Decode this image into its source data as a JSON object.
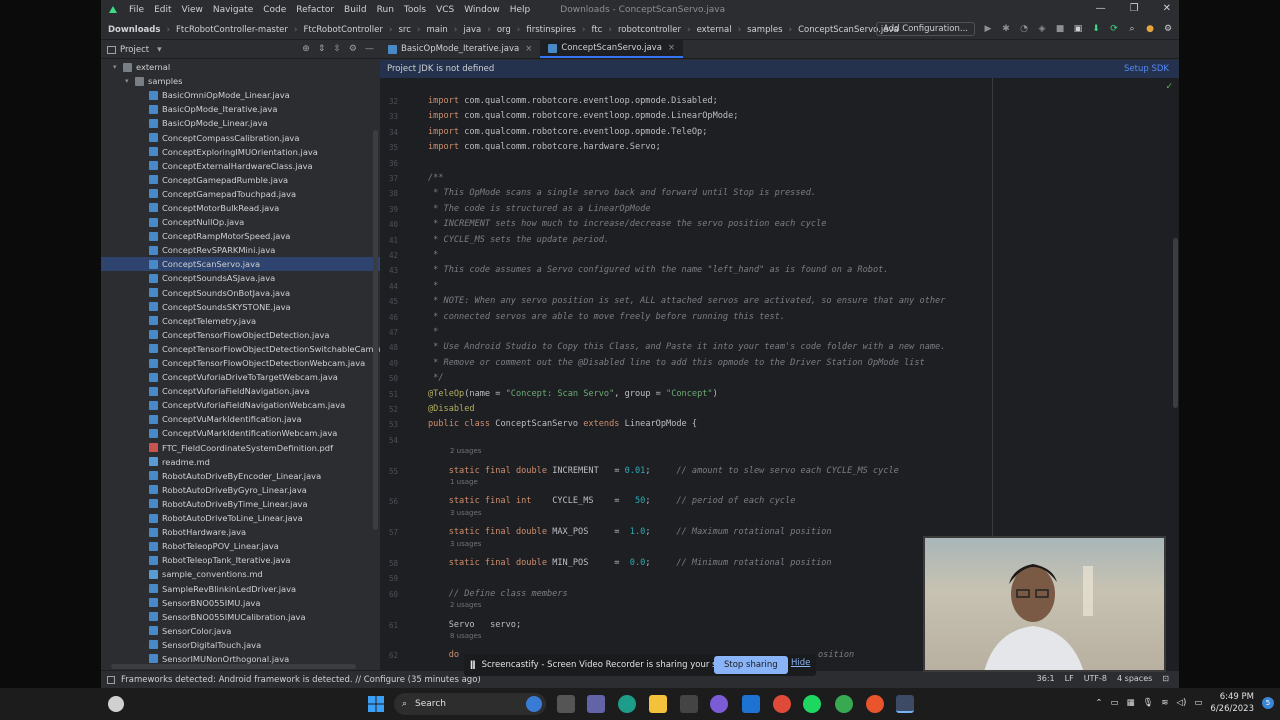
{
  "menubar": {
    "items": [
      "File",
      "Edit",
      "View",
      "Navigate",
      "Code",
      "Refactor",
      "Build",
      "Run",
      "Tools",
      "VCS",
      "Window",
      "Help"
    ],
    "title": "Downloads - ConceptScanServo.java"
  },
  "breadcrumbs": [
    "Downloads",
    "FtcRobotController-master",
    "FtcRobotController",
    "src",
    "main",
    "java",
    "org",
    "firstinspires",
    "ftc",
    "robotcontroller",
    "external",
    "samples",
    "ConceptScanServo.java"
  ],
  "toolbar": {
    "add_config": "Add Configuration..."
  },
  "project_panel": {
    "title": "Project",
    "tree": [
      {
        "label": "external",
        "type": "folder",
        "level": 1,
        "expanded": true
      },
      {
        "label": "samples",
        "type": "folder",
        "level": 2,
        "expanded": true
      },
      {
        "label": "BasicOmniOpMode_Linear.java",
        "type": "java",
        "level": 3
      },
      {
        "label": "BasicOpMode_Iterative.java",
        "type": "java",
        "level": 3
      },
      {
        "label": "BasicOpMode_Linear.java",
        "type": "java",
        "level": 3
      },
      {
        "label": "ConceptCompassCalibration.java",
        "type": "java",
        "level": 3
      },
      {
        "label": "ConceptExploringIMUOrientation.java",
        "type": "java",
        "level": 3
      },
      {
        "label": "ConceptExternalHardwareClass.java",
        "type": "java",
        "level": 3
      },
      {
        "label": "ConceptGamepadRumble.java",
        "type": "java",
        "level": 3
      },
      {
        "label": "ConceptGamepadTouchpad.java",
        "type": "java",
        "level": 3
      },
      {
        "label": "ConceptMotorBulkRead.java",
        "type": "java",
        "level": 3
      },
      {
        "label": "ConceptNullOp.java",
        "type": "java",
        "level": 3
      },
      {
        "label": "ConceptRampMotorSpeed.java",
        "type": "java",
        "level": 3
      },
      {
        "label": "ConceptRevSPARKMini.java",
        "type": "java",
        "level": 3
      },
      {
        "label": "ConceptScanServo.java",
        "type": "java",
        "level": 3,
        "selected": true
      },
      {
        "label": "ConceptSoundsASJava.java",
        "type": "java",
        "level": 3
      },
      {
        "label": "ConceptSoundsOnBotJava.java",
        "type": "java",
        "level": 3
      },
      {
        "label": "ConceptSoundsSKYSTONE.java",
        "type": "java",
        "level": 3
      },
      {
        "label": "ConceptTelemetry.java",
        "type": "java",
        "level": 3
      },
      {
        "label": "ConceptTensorFlowObjectDetection.java",
        "type": "java",
        "level": 3
      },
      {
        "label": "ConceptTensorFlowObjectDetectionSwitchableCameras.ja",
        "type": "java",
        "level": 3
      },
      {
        "label": "ConceptTensorFlowObjectDetectionWebcam.java",
        "type": "java",
        "level": 3
      },
      {
        "label": "ConceptVuforiaDriveToTargetWebcam.java",
        "type": "java",
        "level": 3
      },
      {
        "label": "ConceptVuforiaFieldNavigation.java",
        "type": "java",
        "level": 3
      },
      {
        "label": "ConceptVuforiaFieldNavigationWebcam.java",
        "type": "java",
        "level": 3
      },
      {
        "label": "ConceptVuMarkIdentification.java",
        "type": "java",
        "level": 3
      },
      {
        "label": "ConceptVuMarkIdentificationWebcam.java",
        "type": "java",
        "level": 3
      },
      {
        "label": "FTC_FieldCoordinateSystemDefinition.pdf",
        "type": "pdf",
        "level": 3
      },
      {
        "label": "readme.md",
        "type": "md",
        "level": 3
      },
      {
        "label": "RobotAutoDriveByEncoder_Linear.java",
        "type": "java",
        "level": 3
      },
      {
        "label": "RobotAutoDriveByGyro_Linear.java",
        "type": "java",
        "level": 3
      },
      {
        "label": "RobotAutoDriveByTime_Linear.java",
        "type": "java",
        "level": 3
      },
      {
        "label": "RobotAutoDriveToLine_Linear.java",
        "type": "java",
        "level": 3
      },
      {
        "label": "RobotHardware.java",
        "type": "java",
        "level": 3
      },
      {
        "label": "RobotTeleopPOV_Linear.java",
        "type": "java",
        "level": 3
      },
      {
        "label": "RobotTeleopTank_Iterative.java",
        "type": "java",
        "level": 3
      },
      {
        "label": "sample_conventions.md",
        "type": "md",
        "level": 3
      },
      {
        "label": "SampleRevBlinkinLedDriver.java",
        "type": "java",
        "level": 3
      },
      {
        "label": "SensorBNO055IMU.java",
        "type": "java",
        "level": 3
      },
      {
        "label": "SensorBNO055IMUCalibration.java",
        "type": "java",
        "level": 3
      },
      {
        "label": "SensorColor.java",
        "type": "java",
        "level": 3
      },
      {
        "label": "SensorDigitalTouch.java",
        "type": "java",
        "level": 3
      },
      {
        "label": "SensorIMUNonOrthogonal.java",
        "type": "java",
        "level": 3
      }
    ]
  },
  "tabs": [
    {
      "label": "BasicOpMode_Iterative.java",
      "active": false
    },
    {
      "label": "ConceptScanServo.java",
      "active": true
    }
  ],
  "banner": {
    "text": "Project JDK is not defined",
    "link": "Setup SDK"
  },
  "editor": {
    "lines": [
      {
        "n": "32",
        "tokens": [
          [
            "kw",
            "import "
          ],
          [
            "id",
            "com.qualcomm.robotcore.eventloop.opmode.Disabled;"
          ]
        ]
      },
      {
        "n": "33",
        "tokens": [
          [
            "kw",
            "import "
          ],
          [
            "id",
            "com.qualcomm.robotcore.eventloop.opmode.LinearOpMode;"
          ]
        ]
      },
      {
        "n": "34",
        "tokens": [
          [
            "kw",
            "import "
          ],
          [
            "id",
            "com.qualcomm.robotcore.eventloop.opmode.TeleOp;"
          ]
        ]
      },
      {
        "n": "35",
        "tokens": [
          [
            "kw",
            "import "
          ],
          [
            "id",
            "com.qualcomm.robotcore.hardware.Servo;"
          ]
        ]
      },
      {
        "n": "36",
        "tokens": []
      },
      {
        "n": "37",
        "tokens": [
          [
            "cm",
            "/**"
          ]
        ]
      },
      {
        "n": "38",
        "tokens": [
          [
            "cm",
            " * This OpMode scans a single servo back and forward until Stop is pressed."
          ]
        ]
      },
      {
        "n": "39",
        "tokens": [
          [
            "cm",
            " * The code is structured as a LinearOpMode"
          ]
        ]
      },
      {
        "n": "40",
        "tokens": [
          [
            "cm",
            " * INCREMENT sets how much to increase/decrease the servo position each cycle"
          ]
        ]
      },
      {
        "n": "41",
        "tokens": [
          [
            "cm",
            " * CYCLE_MS sets the update period."
          ]
        ]
      },
      {
        "n": "42",
        "tokens": [
          [
            "cm",
            " *"
          ]
        ]
      },
      {
        "n": "43",
        "tokens": [
          [
            "cm",
            " * This code assumes a Servo configured with the name \"left_hand\" as is found on a Robot."
          ]
        ]
      },
      {
        "n": "44",
        "tokens": [
          [
            "cm",
            " *"
          ]
        ]
      },
      {
        "n": "45",
        "tokens": [
          [
            "cm",
            " * NOTE: When any servo position is set, ALL attached servos are activated, so ensure that any other"
          ]
        ]
      },
      {
        "n": "46",
        "tokens": [
          [
            "cm",
            " * connected servos are able to move freely before running this test."
          ]
        ]
      },
      {
        "n": "47",
        "tokens": [
          [
            "cm",
            " *"
          ]
        ]
      },
      {
        "n": "48",
        "tokens": [
          [
            "cm",
            " * Use Android Studio to Copy this Class, and Paste it into your team's code folder with a new name."
          ]
        ]
      },
      {
        "n": "49",
        "tokens": [
          [
            "cm",
            " * Remove or comment out the @Disabled line to add this opmode to the Driver Station OpMode list"
          ]
        ]
      },
      {
        "n": "50",
        "tokens": [
          [
            "cm",
            " */"
          ]
        ]
      },
      {
        "n": "51",
        "tokens": [
          [
            "an",
            "@TeleOp"
          ],
          [
            "id",
            "(name = "
          ],
          [
            "st",
            "\"Concept: Scan Servo\""
          ],
          [
            "id",
            ", group = "
          ],
          [
            "st",
            "\"Concept\""
          ],
          [
            "id",
            ")"
          ]
        ]
      },
      {
        "n": "52",
        "tokens": [
          [
            "an",
            "@Disabled"
          ]
        ]
      },
      {
        "n": "53",
        "tokens": [
          [
            "kw",
            "public class "
          ],
          [
            "id",
            "ConceptScanServo "
          ],
          [
            "kw",
            "extends "
          ],
          [
            "id",
            "LinearOpMode {"
          ]
        ]
      },
      {
        "n": "54",
        "tokens": []
      },
      {
        "n": "55",
        "usage": "2 usages",
        "tokens": [
          [
            "kw",
            "    static final double "
          ],
          [
            "id",
            "INCREMENT   = "
          ],
          [
            "nm",
            "0.01"
          ],
          [
            "id",
            ";     "
          ],
          [
            "cm",
            "// amount to slew servo each CYCLE_MS cycle"
          ]
        ]
      },
      {
        "n": "56",
        "usage": "1 usage",
        "tokens": [
          [
            "kw",
            "    static final int    "
          ],
          [
            "id",
            "CYCLE_MS    =   "
          ],
          [
            "nm",
            "50"
          ],
          [
            "id",
            ";     "
          ],
          [
            "cm",
            "// period of each cycle"
          ]
        ]
      },
      {
        "n": "57",
        "usage": "3 usages",
        "tokens": [
          [
            "kw",
            "    static final double "
          ],
          [
            "id",
            "MAX_POS     =  "
          ],
          [
            "nm",
            "1.0"
          ],
          [
            "id",
            ";     "
          ],
          [
            "cm",
            "// Maximum rotational position"
          ]
        ]
      },
      {
        "n": "58",
        "usage": "3 usages",
        "tokens": [
          [
            "kw",
            "    static final double "
          ],
          [
            "id",
            "MIN_POS     =  "
          ],
          [
            "nm",
            "0.0"
          ],
          [
            "id",
            ";     "
          ],
          [
            "cm",
            "// Minimum rotational position"
          ]
        ]
      },
      {
        "n": "59",
        "tokens": []
      },
      {
        "n": "60",
        "tokens": [
          [
            "cm",
            "    // Define class members"
          ]
        ]
      },
      {
        "n": "61",
        "usage": "2 usages",
        "tokens": [
          [
            "id",
            "    Servo   servo;"
          ]
        ]
      },
      {
        "n": "62",
        "usage": "8 usages",
        "tokens": [
          [
            "kw",
            "    do"
          ]
        ]
      }
    ],
    "line_63_tail": "osition"
  },
  "statusbar": {
    "message": "Frameworks detected: Android framework is detected. // Configure (35 minutes ago)",
    "position": "36:1",
    "line_sep": "LF",
    "encoding": "UTF-8",
    "indent": "4 spaces"
  },
  "share_bar": {
    "text": "Screencastify - Screen Video Recorder is sharing your screen.",
    "stop_label": "Stop sharing",
    "hide_label": "Hide"
  },
  "taskbar": {
    "search_label": "Search",
    "time": "6:49 PM",
    "date": "6/26/2023",
    "notif_count": "5"
  }
}
